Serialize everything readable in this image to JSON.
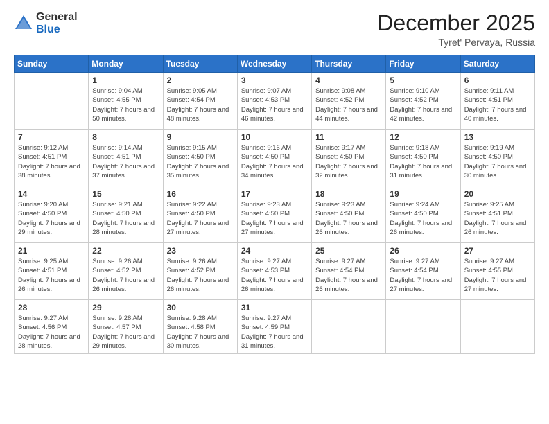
{
  "logo": {
    "general": "General",
    "blue": "Blue"
  },
  "header": {
    "month": "December 2025",
    "location": "Tyret' Pervaya, Russia"
  },
  "weekdays": [
    "Sunday",
    "Monday",
    "Tuesday",
    "Wednesday",
    "Thursday",
    "Friday",
    "Saturday"
  ],
  "weeks": [
    [
      {
        "day": "",
        "sunrise": "",
        "sunset": "",
        "daylight": ""
      },
      {
        "day": "1",
        "sunrise": "Sunrise: 9:04 AM",
        "sunset": "Sunset: 4:55 PM",
        "daylight": "Daylight: 7 hours and 50 minutes."
      },
      {
        "day": "2",
        "sunrise": "Sunrise: 9:05 AM",
        "sunset": "Sunset: 4:54 PM",
        "daylight": "Daylight: 7 hours and 48 minutes."
      },
      {
        "day": "3",
        "sunrise": "Sunrise: 9:07 AM",
        "sunset": "Sunset: 4:53 PM",
        "daylight": "Daylight: 7 hours and 46 minutes."
      },
      {
        "day": "4",
        "sunrise": "Sunrise: 9:08 AM",
        "sunset": "Sunset: 4:52 PM",
        "daylight": "Daylight: 7 hours and 44 minutes."
      },
      {
        "day": "5",
        "sunrise": "Sunrise: 9:10 AM",
        "sunset": "Sunset: 4:52 PM",
        "daylight": "Daylight: 7 hours and 42 minutes."
      },
      {
        "day": "6",
        "sunrise": "Sunrise: 9:11 AM",
        "sunset": "Sunset: 4:51 PM",
        "daylight": "Daylight: 7 hours and 40 minutes."
      }
    ],
    [
      {
        "day": "7",
        "sunrise": "Sunrise: 9:12 AM",
        "sunset": "Sunset: 4:51 PM",
        "daylight": "Daylight: 7 hours and 38 minutes."
      },
      {
        "day": "8",
        "sunrise": "Sunrise: 9:14 AM",
        "sunset": "Sunset: 4:51 PM",
        "daylight": "Daylight: 7 hours and 37 minutes."
      },
      {
        "day": "9",
        "sunrise": "Sunrise: 9:15 AM",
        "sunset": "Sunset: 4:50 PM",
        "daylight": "Daylight: 7 hours and 35 minutes."
      },
      {
        "day": "10",
        "sunrise": "Sunrise: 9:16 AM",
        "sunset": "Sunset: 4:50 PM",
        "daylight": "Daylight: 7 hours and 34 minutes."
      },
      {
        "day": "11",
        "sunrise": "Sunrise: 9:17 AM",
        "sunset": "Sunset: 4:50 PM",
        "daylight": "Daylight: 7 hours and 32 minutes."
      },
      {
        "day": "12",
        "sunrise": "Sunrise: 9:18 AM",
        "sunset": "Sunset: 4:50 PM",
        "daylight": "Daylight: 7 hours and 31 minutes."
      },
      {
        "day": "13",
        "sunrise": "Sunrise: 9:19 AM",
        "sunset": "Sunset: 4:50 PM",
        "daylight": "Daylight: 7 hours and 30 minutes."
      }
    ],
    [
      {
        "day": "14",
        "sunrise": "Sunrise: 9:20 AM",
        "sunset": "Sunset: 4:50 PM",
        "daylight": "Daylight: 7 hours and 29 minutes."
      },
      {
        "day": "15",
        "sunrise": "Sunrise: 9:21 AM",
        "sunset": "Sunset: 4:50 PM",
        "daylight": "Daylight: 7 hours and 28 minutes."
      },
      {
        "day": "16",
        "sunrise": "Sunrise: 9:22 AM",
        "sunset": "Sunset: 4:50 PM",
        "daylight": "Daylight: 7 hours and 27 minutes."
      },
      {
        "day": "17",
        "sunrise": "Sunrise: 9:23 AM",
        "sunset": "Sunset: 4:50 PM",
        "daylight": "Daylight: 7 hours and 27 minutes."
      },
      {
        "day": "18",
        "sunrise": "Sunrise: 9:23 AM",
        "sunset": "Sunset: 4:50 PM",
        "daylight": "Daylight: 7 hours and 26 minutes."
      },
      {
        "day": "19",
        "sunrise": "Sunrise: 9:24 AM",
        "sunset": "Sunset: 4:50 PM",
        "daylight": "Daylight: 7 hours and 26 minutes."
      },
      {
        "day": "20",
        "sunrise": "Sunrise: 9:25 AM",
        "sunset": "Sunset: 4:51 PM",
        "daylight": "Daylight: 7 hours and 26 minutes."
      }
    ],
    [
      {
        "day": "21",
        "sunrise": "Sunrise: 9:25 AM",
        "sunset": "Sunset: 4:51 PM",
        "daylight": "Daylight: 7 hours and 26 minutes."
      },
      {
        "day": "22",
        "sunrise": "Sunrise: 9:26 AM",
        "sunset": "Sunset: 4:52 PM",
        "daylight": "Daylight: 7 hours and 26 minutes."
      },
      {
        "day": "23",
        "sunrise": "Sunrise: 9:26 AM",
        "sunset": "Sunset: 4:52 PM",
        "daylight": "Daylight: 7 hours and 26 minutes."
      },
      {
        "day": "24",
        "sunrise": "Sunrise: 9:27 AM",
        "sunset": "Sunset: 4:53 PM",
        "daylight": "Daylight: 7 hours and 26 minutes."
      },
      {
        "day": "25",
        "sunrise": "Sunrise: 9:27 AM",
        "sunset": "Sunset: 4:54 PM",
        "daylight": "Daylight: 7 hours and 26 minutes."
      },
      {
        "day": "26",
        "sunrise": "Sunrise: 9:27 AM",
        "sunset": "Sunset: 4:54 PM",
        "daylight": "Daylight: 7 hours and 27 minutes."
      },
      {
        "day": "27",
        "sunrise": "Sunrise: 9:27 AM",
        "sunset": "Sunset: 4:55 PM",
        "daylight": "Daylight: 7 hours and 27 minutes."
      }
    ],
    [
      {
        "day": "28",
        "sunrise": "Sunrise: 9:27 AM",
        "sunset": "Sunset: 4:56 PM",
        "daylight": "Daylight: 7 hours and 28 minutes."
      },
      {
        "day": "29",
        "sunrise": "Sunrise: 9:28 AM",
        "sunset": "Sunset: 4:57 PM",
        "daylight": "Daylight: 7 hours and 29 minutes."
      },
      {
        "day": "30",
        "sunrise": "Sunrise: 9:28 AM",
        "sunset": "Sunset: 4:58 PM",
        "daylight": "Daylight: 7 hours and 30 minutes."
      },
      {
        "day": "31",
        "sunrise": "Sunrise: 9:27 AM",
        "sunset": "Sunset: 4:59 PM",
        "daylight": "Daylight: 7 hours and 31 minutes."
      },
      {
        "day": "",
        "sunrise": "",
        "sunset": "",
        "daylight": ""
      },
      {
        "day": "",
        "sunrise": "",
        "sunset": "",
        "daylight": ""
      },
      {
        "day": "",
        "sunrise": "",
        "sunset": "",
        "daylight": ""
      }
    ]
  ]
}
